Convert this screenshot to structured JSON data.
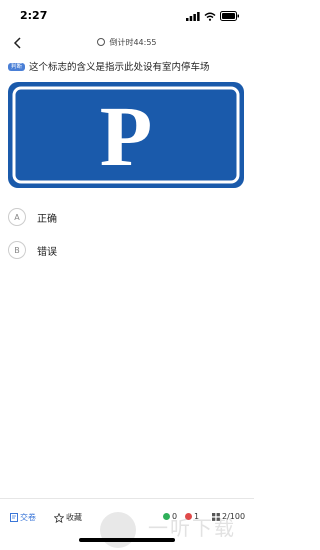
{
  "status_bar": {
    "time": "2:27"
  },
  "nav": {
    "timer": "倒计时44:55"
  },
  "question": {
    "type_badge": "判断",
    "text": "这个标志的含义是指示此处设有室内停车场",
    "sign": {
      "letter": "P",
      "color": "#1a5aab"
    }
  },
  "options": [
    {
      "letter": "A",
      "text": "正确"
    },
    {
      "letter": "B",
      "text": "错误"
    }
  ],
  "bottom_bar": {
    "submit": "交卷",
    "favorite": "收藏",
    "correct_count": "0",
    "wrong_count": "1",
    "progress": "2/100"
  },
  "watermark": {
    "text": "一听下载"
  },
  "colors": {
    "accent": "#3a76d8",
    "correct": "#2fb05a",
    "wrong": "#e04a4a"
  }
}
